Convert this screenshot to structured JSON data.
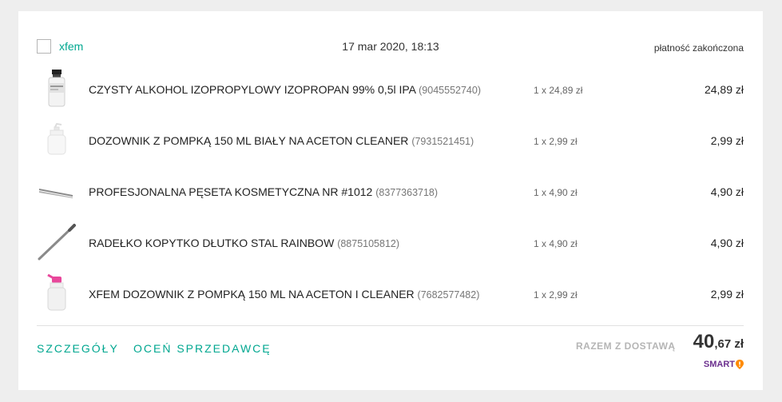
{
  "order": {
    "seller": "xfem",
    "date": "17 mar 2020, 18:13",
    "status": "płatność zakończona"
  },
  "items": [
    {
      "title": "CZYSTY ALKOHOL IZOPROPYLOWY IZOPROPAN 99% 0,5l IPA",
      "offer_id": "(9045552740)",
      "qty": "1 x 24,89 zł",
      "price": "24,89 zł",
      "icon": "alcohol-bottle-icon"
    },
    {
      "title": "DOZOWNIK Z POMPKĄ 150 ML BIAŁY NA ACETON CLEANER",
      "offer_id": "(7931521451)",
      "qty": "1 x 2,99 zł",
      "price": "2,99 zł",
      "icon": "pump-dispenser-icon"
    },
    {
      "title": "PROFESJONALNA PĘSETA KOSMETYCZNA NR #1012",
      "offer_id": "(8377363718)",
      "qty": "1 x 4,90 zł",
      "price": "4,90 zł",
      "icon": "tweezers-icon"
    },
    {
      "title": "RADEŁKO KOPYTKO DŁUTKO STAL RAINBOW",
      "offer_id": "(8875105812)",
      "qty": "1 x 4,90 zł",
      "price": "4,90 zł",
      "icon": "cuticle-pusher-icon"
    },
    {
      "title": "XFEM DOZOWNIK Z POMPKĄ 150 ML NA ACETON I CLEANER",
      "offer_id": "(7682577482)",
      "qty": "1 x 2,99 zł",
      "price": "2,99 zł",
      "icon": "pink-pump-dispenser-icon"
    }
  ],
  "footer": {
    "details_link": "SZCZEGÓŁY",
    "rate_link": "OCEŃ SPRZEDAWCĘ",
    "total_label": "RAZEM Z DOSTAWĄ",
    "total_main": "40",
    "total_cents": ",67 zł",
    "smart_label": "SMART"
  },
  "colors": {
    "accent": "#00a790",
    "smart": "#6b2f8e",
    "smart_pin": "#ff8a00",
    "background": "#eeeeee"
  }
}
